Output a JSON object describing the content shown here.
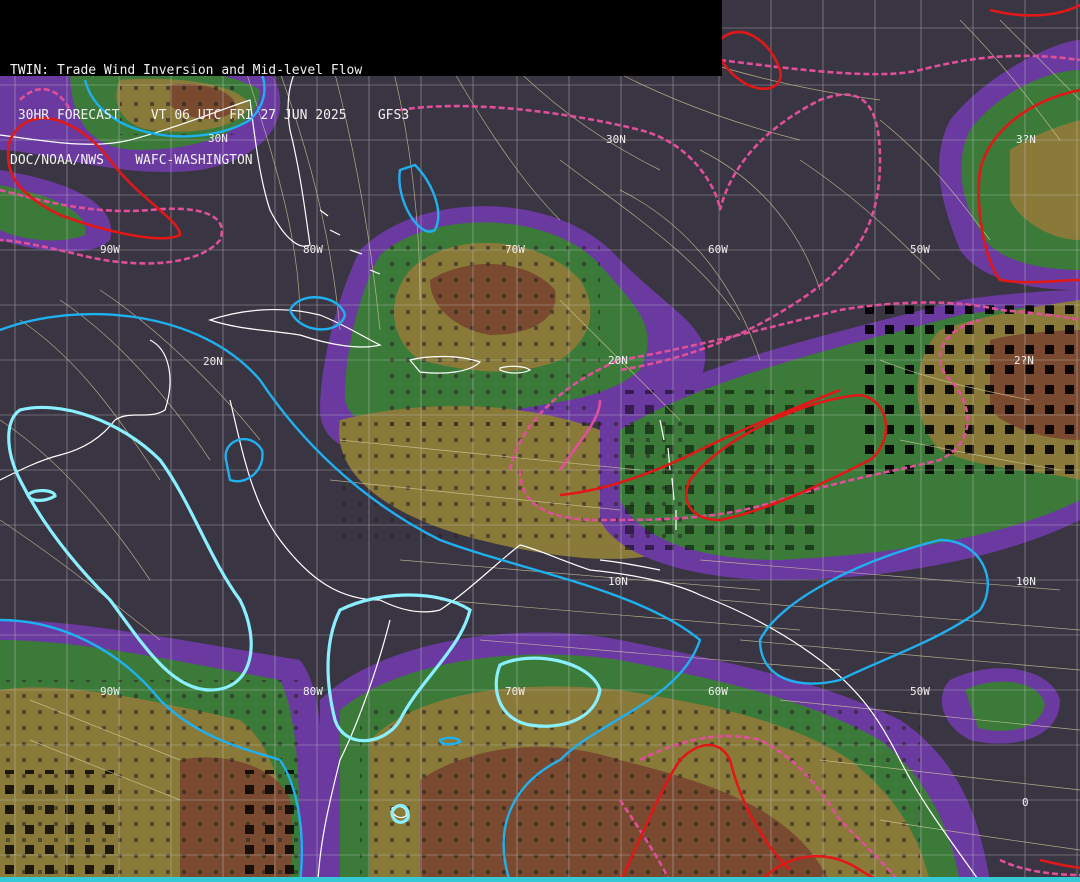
{
  "header": {
    "line1": "TWIN: Trade Wind Inversion and Mid-level Flow",
    "line2": " 30HR FORECAST    VT 06 UTC FRI 27 JUN 2025    GFS3",
    "line3": "DOC/NOAA/NWS    WAFC-WASHINGTON"
  },
  "grid_labels": {
    "lat_30n_a": "30N",
    "lat_30n_b": "30N",
    "lat_30n_c": "3?N",
    "lat_20n_a": "20N",
    "lat_20n_b": "20N",
    "lat_20n_c": "2?N",
    "lat_10n_a": "10N",
    "lat_10n_b": "10N",
    "lat_0": "0",
    "lon_90w_a": "90W",
    "lon_80w_a": "80W",
    "lon_70w_a": "70W",
    "lon_60w_a": "60W",
    "lon_50w_a": "50W",
    "lon_90w_b": "90W",
    "lon_80w_b": "80W",
    "lon_70w_b": "70W",
    "lon_60w_b": "60W",
    "lon_50w_b": "50W"
  },
  "colors": {
    "background": "#3a3542",
    "purple_band": "#6a3aa0",
    "blue_band": "#4a4a9a",
    "green": "#3c7a3a",
    "olive": "#8a7a3a",
    "brown": "#7a4a30",
    "red_contour": "#e01818",
    "pink_dashed": "#e0509a",
    "cyan_contour": "#20b0f0",
    "streamline": "#d8d0a0",
    "coastline": "#ffffff",
    "grid": "#c0c0c0",
    "bottom_bar": "#35c9d6"
  }
}
